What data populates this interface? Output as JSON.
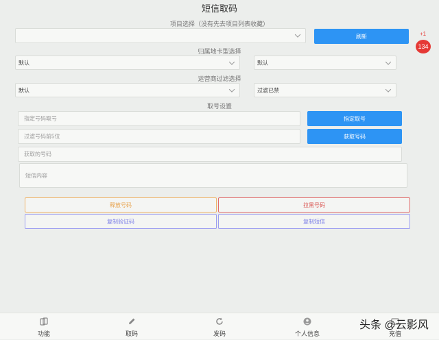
{
  "page_title": "短信取码",
  "project": {
    "label": "项目选择（没有先去项目列表收藏）",
    "selected": "",
    "refresh_label": "刷新"
  },
  "badge": {
    "plus": "+1",
    "count": "134"
  },
  "region": {
    "label": "归属地卡型选择",
    "left_selected": "默认",
    "right_selected": "默认"
  },
  "carrier": {
    "label": "运营商过滤选择",
    "left_selected": "默认",
    "right_selected": "过滤已禁"
  },
  "number": {
    "label": "取号设置",
    "specify_placeholder": "指定号码取号",
    "specify_button": "指定取号",
    "filter_placeholder": "过滤号码前5位",
    "get_button": "获取号码",
    "obtained_placeholder": "获取的号码",
    "sms_placeholder": "短信内容"
  },
  "actions": {
    "release": "释放号码",
    "blacklist": "拉黑号码",
    "copy_code": "复制验证码",
    "copy_sms": "复制短信"
  },
  "colors": {
    "primary": "#2d94f4",
    "release": "#f0b46a",
    "blacklist": "#e06a6a",
    "copy": "#9b9df0",
    "badge": "#e53935"
  },
  "tabs": [
    {
      "label": "功能",
      "icon": "feature-icon"
    },
    {
      "label": "取码",
      "icon": "pencil-icon"
    },
    {
      "label": "发码",
      "icon": "refresh-icon"
    },
    {
      "label": "个人信息",
      "icon": "user-icon"
    },
    {
      "label": "充值",
      "icon": "recharge-icon"
    }
  ],
  "watermark": "头条 @云影风"
}
